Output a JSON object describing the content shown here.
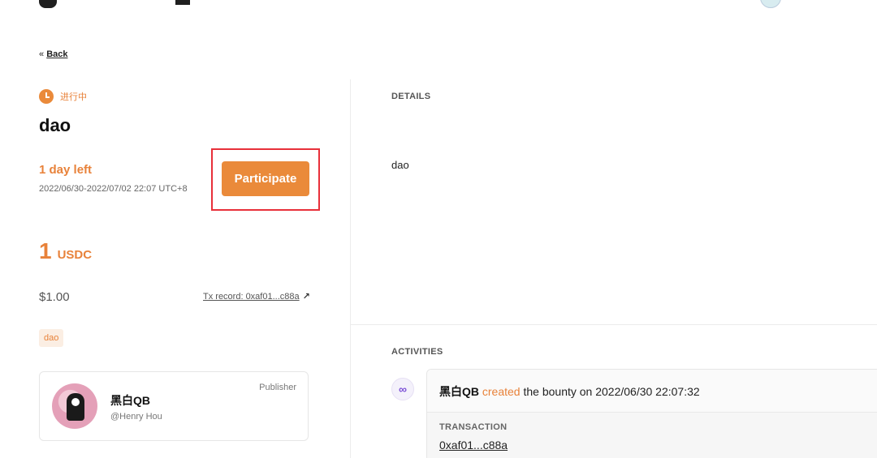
{
  "back": {
    "prefix": "«",
    "label": "Back"
  },
  "bounty": {
    "status": "进行中",
    "title": "dao",
    "time_left": "1 day left",
    "date_range": "2022/06/30-2022/07/02 22:07 UTC+8",
    "participate_label": "Participate",
    "amount": "1",
    "unit": "USDC",
    "usd_value": "$1.00",
    "tx_record": "Tx record: 0xaf01...c88a",
    "tag": "dao"
  },
  "publisher": {
    "name": "黑白QB",
    "handle": "@Henry Hou",
    "role": "Publisher"
  },
  "details": {
    "label": "DETAILS",
    "body": "dao"
  },
  "activities": {
    "label": "ACTIVITIES",
    "items": [
      {
        "actor": "黑白QB",
        "verb": "created",
        "text": "the bounty on 2022/06/30 22:07:32",
        "transaction_label": "TRANSACTION",
        "transaction_hash": "0xaf01...c88a"
      }
    ]
  },
  "colors": {
    "accent": "#ea8a3a",
    "highlight_box": "#e8303a"
  },
  "icons": {
    "status": "clock-icon",
    "tx_external": "external-link-icon",
    "activity": "polygon-icon"
  }
}
